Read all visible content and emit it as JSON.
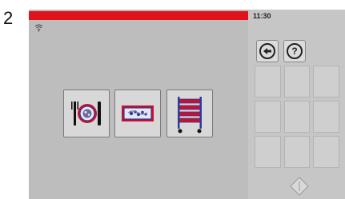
{
  "step_number": "2",
  "status": {
    "time": "11:30",
    "wifi_icon": "wifi-icon"
  },
  "colors": {
    "red_bar": "#e0121b",
    "screen_bg": "#bdbdbd",
    "panel_bg": "#c6c6c6",
    "icon_blue": "#2a3c9c",
    "icon_red": "#c8102e"
  },
  "nav": {
    "back_icon": "arrow-left-icon",
    "help_label": "?"
  },
  "tiles": [
    {
      "name": "plate-dish-mode",
      "icon": "plate-with-cutlery-icon"
    },
    {
      "name": "tray-dish-mode",
      "icon": "food-tray-icon"
    },
    {
      "name": "rack-trolley-mode",
      "icon": "rack-trolley-icon"
    }
  ],
  "start_icon": "start-diamond-icon"
}
